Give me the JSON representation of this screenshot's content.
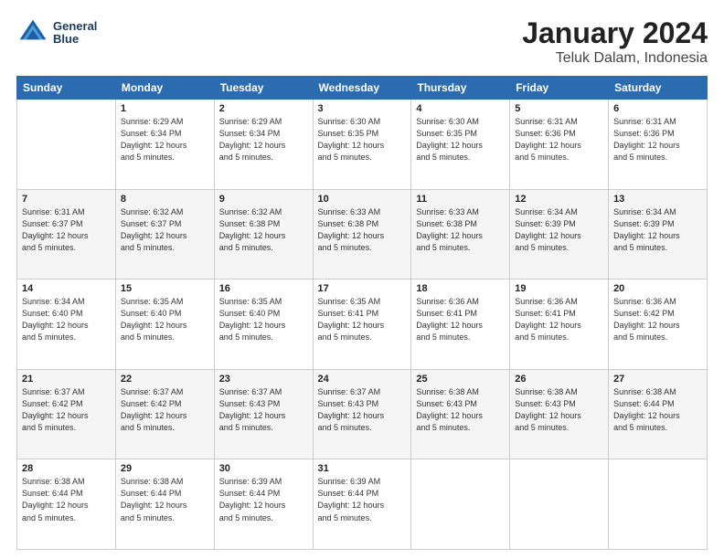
{
  "header": {
    "logo_line1": "General",
    "logo_line2": "Blue",
    "title": "January 2024",
    "subtitle": "Teluk Dalam, Indonesia"
  },
  "days_of_week": [
    "Sunday",
    "Monday",
    "Tuesday",
    "Wednesday",
    "Thursday",
    "Friday",
    "Saturday"
  ],
  "weeks": [
    [
      {
        "day": "",
        "info": ""
      },
      {
        "day": "1",
        "info": "Sunrise: 6:29 AM\nSunset: 6:34 PM\nDaylight: 12 hours\nand 5 minutes."
      },
      {
        "day": "2",
        "info": "Sunrise: 6:29 AM\nSunset: 6:34 PM\nDaylight: 12 hours\nand 5 minutes."
      },
      {
        "day": "3",
        "info": "Sunrise: 6:30 AM\nSunset: 6:35 PM\nDaylight: 12 hours\nand 5 minutes."
      },
      {
        "day": "4",
        "info": "Sunrise: 6:30 AM\nSunset: 6:35 PM\nDaylight: 12 hours\nand 5 minutes."
      },
      {
        "day": "5",
        "info": "Sunrise: 6:31 AM\nSunset: 6:36 PM\nDaylight: 12 hours\nand 5 minutes."
      },
      {
        "day": "6",
        "info": "Sunrise: 6:31 AM\nSunset: 6:36 PM\nDaylight: 12 hours\nand 5 minutes."
      }
    ],
    [
      {
        "day": "7",
        "info": "Sunrise: 6:31 AM\nSunset: 6:37 PM\nDaylight: 12 hours\nand 5 minutes."
      },
      {
        "day": "8",
        "info": "Sunrise: 6:32 AM\nSunset: 6:37 PM\nDaylight: 12 hours\nand 5 minutes."
      },
      {
        "day": "9",
        "info": "Sunrise: 6:32 AM\nSunset: 6:38 PM\nDaylight: 12 hours\nand 5 minutes."
      },
      {
        "day": "10",
        "info": "Sunrise: 6:33 AM\nSunset: 6:38 PM\nDaylight: 12 hours\nand 5 minutes."
      },
      {
        "day": "11",
        "info": "Sunrise: 6:33 AM\nSunset: 6:38 PM\nDaylight: 12 hours\nand 5 minutes."
      },
      {
        "day": "12",
        "info": "Sunrise: 6:34 AM\nSunset: 6:39 PM\nDaylight: 12 hours\nand 5 minutes."
      },
      {
        "day": "13",
        "info": "Sunrise: 6:34 AM\nSunset: 6:39 PM\nDaylight: 12 hours\nand 5 minutes."
      }
    ],
    [
      {
        "day": "14",
        "info": "Sunrise: 6:34 AM\nSunset: 6:40 PM\nDaylight: 12 hours\nand 5 minutes."
      },
      {
        "day": "15",
        "info": "Sunrise: 6:35 AM\nSunset: 6:40 PM\nDaylight: 12 hours\nand 5 minutes."
      },
      {
        "day": "16",
        "info": "Sunrise: 6:35 AM\nSunset: 6:40 PM\nDaylight: 12 hours\nand 5 minutes."
      },
      {
        "day": "17",
        "info": "Sunrise: 6:35 AM\nSunset: 6:41 PM\nDaylight: 12 hours\nand 5 minutes."
      },
      {
        "day": "18",
        "info": "Sunrise: 6:36 AM\nSunset: 6:41 PM\nDaylight: 12 hours\nand 5 minutes."
      },
      {
        "day": "19",
        "info": "Sunrise: 6:36 AM\nSunset: 6:41 PM\nDaylight: 12 hours\nand 5 minutes."
      },
      {
        "day": "20",
        "info": "Sunrise: 6:36 AM\nSunset: 6:42 PM\nDaylight: 12 hours\nand 5 minutes."
      }
    ],
    [
      {
        "day": "21",
        "info": "Sunrise: 6:37 AM\nSunset: 6:42 PM\nDaylight: 12 hours\nand 5 minutes."
      },
      {
        "day": "22",
        "info": "Sunrise: 6:37 AM\nSunset: 6:42 PM\nDaylight: 12 hours\nand 5 minutes."
      },
      {
        "day": "23",
        "info": "Sunrise: 6:37 AM\nSunset: 6:43 PM\nDaylight: 12 hours\nand 5 minutes."
      },
      {
        "day": "24",
        "info": "Sunrise: 6:37 AM\nSunset: 6:43 PM\nDaylight: 12 hours\nand 5 minutes."
      },
      {
        "day": "25",
        "info": "Sunrise: 6:38 AM\nSunset: 6:43 PM\nDaylight: 12 hours\nand 5 minutes."
      },
      {
        "day": "26",
        "info": "Sunrise: 6:38 AM\nSunset: 6:43 PM\nDaylight: 12 hours\nand 5 minutes."
      },
      {
        "day": "27",
        "info": "Sunrise: 6:38 AM\nSunset: 6:44 PM\nDaylight: 12 hours\nand 5 minutes."
      }
    ],
    [
      {
        "day": "28",
        "info": "Sunrise: 6:38 AM\nSunset: 6:44 PM\nDaylight: 12 hours\nand 5 minutes."
      },
      {
        "day": "29",
        "info": "Sunrise: 6:38 AM\nSunset: 6:44 PM\nDaylight: 12 hours\nand 5 minutes."
      },
      {
        "day": "30",
        "info": "Sunrise: 6:39 AM\nSunset: 6:44 PM\nDaylight: 12 hours\nand 5 minutes."
      },
      {
        "day": "31",
        "info": "Sunrise: 6:39 AM\nSunset: 6:44 PM\nDaylight: 12 hours\nand 5 minutes."
      },
      {
        "day": "",
        "info": ""
      },
      {
        "day": "",
        "info": ""
      },
      {
        "day": "",
        "info": ""
      }
    ]
  ]
}
